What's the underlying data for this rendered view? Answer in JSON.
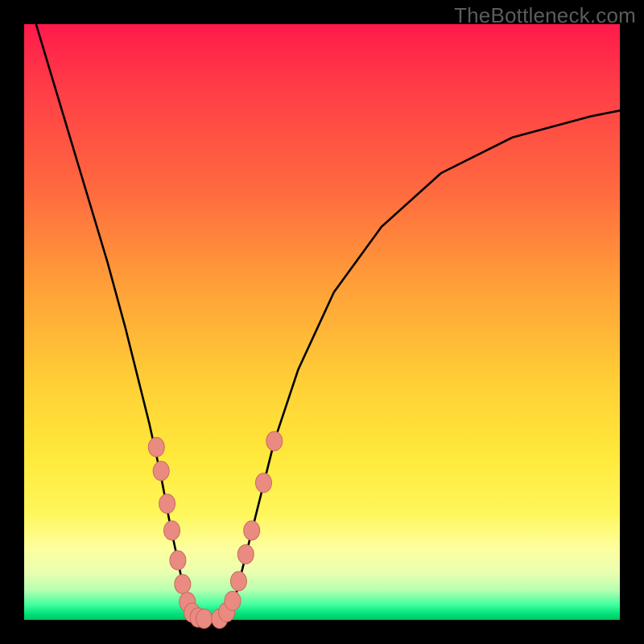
{
  "watermark": "TheBottleneck.com",
  "chart_data": {
    "type": "line",
    "title": "",
    "xlabel": "",
    "ylabel": "",
    "ylim": [
      0,
      100
    ],
    "xlim": [
      0,
      100
    ],
    "series": [
      {
        "name": "curve",
        "x": [
          2,
          5,
          8,
          11,
          14,
          17,
          19,
          21,
          23,
          24.5,
          26,
          27,
          28,
          29,
          30,
          33,
          34,
          35.5,
          37,
          39,
          42,
          46,
          52,
          60,
          70,
          82,
          95,
          100
        ],
        "y": [
          100,
          90,
          80,
          70,
          60,
          49,
          41,
          33,
          24,
          16,
          9,
          4,
          1,
          0,
          0,
          0,
          1,
          4,
          10,
          18,
          30,
          42,
          55,
          66,
          75,
          81,
          84.5,
          85.5
        ]
      }
    ],
    "markers": [
      {
        "cluster": "left",
        "x": 22.2,
        "y": 29
      },
      {
        "cluster": "left",
        "x": 23.0,
        "y": 25
      },
      {
        "cluster": "left",
        "x": 24.0,
        "y": 19.5
      },
      {
        "cluster": "left",
        "x": 24.8,
        "y": 15
      },
      {
        "cluster": "left",
        "x": 25.8,
        "y": 10
      },
      {
        "cluster": "left",
        "x": 26.6,
        "y": 6
      },
      {
        "cluster": "left",
        "x": 27.4,
        "y": 3
      },
      {
        "cluster": "left",
        "x": 28.2,
        "y": 1.2
      },
      {
        "cluster": "left",
        "x": 29.2,
        "y": 0.4
      },
      {
        "cluster": "left",
        "x": 30.2,
        "y": 0.2
      },
      {
        "cluster": "left",
        "x": 32.8,
        "y": 0.2
      },
      {
        "cluster": "right",
        "x": 34.0,
        "y": 1.3
      },
      {
        "cluster": "right",
        "x": 35.0,
        "y": 3.2
      },
      {
        "cluster": "right",
        "x": 36.0,
        "y": 6.5
      },
      {
        "cluster": "right",
        "x": 37.2,
        "y": 11
      },
      {
        "cluster": "right",
        "x": 38.2,
        "y": 15
      },
      {
        "cluster": "right",
        "x": 40.2,
        "y": 23
      },
      {
        "cluster": "right",
        "x": 42.0,
        "y": 30
      }
    ],
    "colors": {
      "curve_stroke": "#000000",
      "marker_fill": "#e98b81",
      "marker_stroke": "#c96a60"
    }
  }
}
